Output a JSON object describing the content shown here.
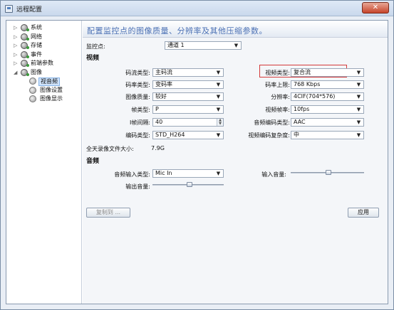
{
  "window": {
    "title": "远程配置",
    "close_glyph": "✕"
  },
  "tree": {
    "items": [
      {
        "label": "系统",
        "expanded": false
      },
      {
        "label": "网络",
        "expanded": false
      },
      {
        "label": "存储",
        "expanded": false
      },
      {
        "label": "事件",
        "expanded": false
      },
      {
        "label": "前端参数",
        "expanded": false
      },
      {
        "label": "图像",
        "expanded": true
      },
      {
        "label": "视音频",
        "selected": true
      },
      {
        "label": "图像设置"
      },
      {
        "label": "图像显示"
      }
    ],
    "collapsed_glyph": "▷",
    "expanded_glyph": "◢"
  },
  "header": {
    "text": "配置监控点的图像质量、分辨率及其他压缩参数。"
  },
  "monitor": {
    "label": "监控点:",
    "value": "通道 1"
  },
  "video": {
    "section": "视频",
    "left": [
      {
        "label": "码流类型:",
        "value": "主码流"
      },
      {
        "label": "码率类型:",
        "value": "变码率"
      },
      {
        "label": "图像质量:",
        "value": "较好"
      },
      {
        "label": "帧类型:",
        "value": "P"
      },
      {
        "label": "I帧间隔:",
        "value": "40"
      },
      {
        "label": "编码类型:",
        "value": "STD_H264"
      }
    ],
    "right": [
      {
        "label": "视频类型:",
        "value": "复合流"
      },
      {
        "label": "码率上限:",
        "value": "768 Kbps"
      },
      {
        "label": "分辨率:",
        "value": "4CIF(704*576)"
      },
      {
        "label": "视频帧率:",
        "value": "10fps"
      },
      {
        "label": "音频编码类型:",
        "value": "AAC"
      },
      {
        "label": "视频编码复杂度:",
        "value": "中"
      }
    ],
    "file_size_label": "全天录像文件大小:",
    "file_size_value": "7.9G"
  },
  "audio": {
    "section": "音频",
    "input_type_label": "音频输入类型:",
    "input_type_value": "Mic In",
    "input_volume_label": "输入音量:",
    "input_volume_level": 0.52,
    "output_volume_label": "输出音量:",
    "output_volume_level": 0.52
  },
  "buttons": {
    "copy_to": "复制到 ...",
    "apply": "应用"
  },
  "colors": {
    "header_text": "#4d72b5",
    "highlight_border": "#d43a3a",
    "selection": "#cfe3fb"
  }
}
